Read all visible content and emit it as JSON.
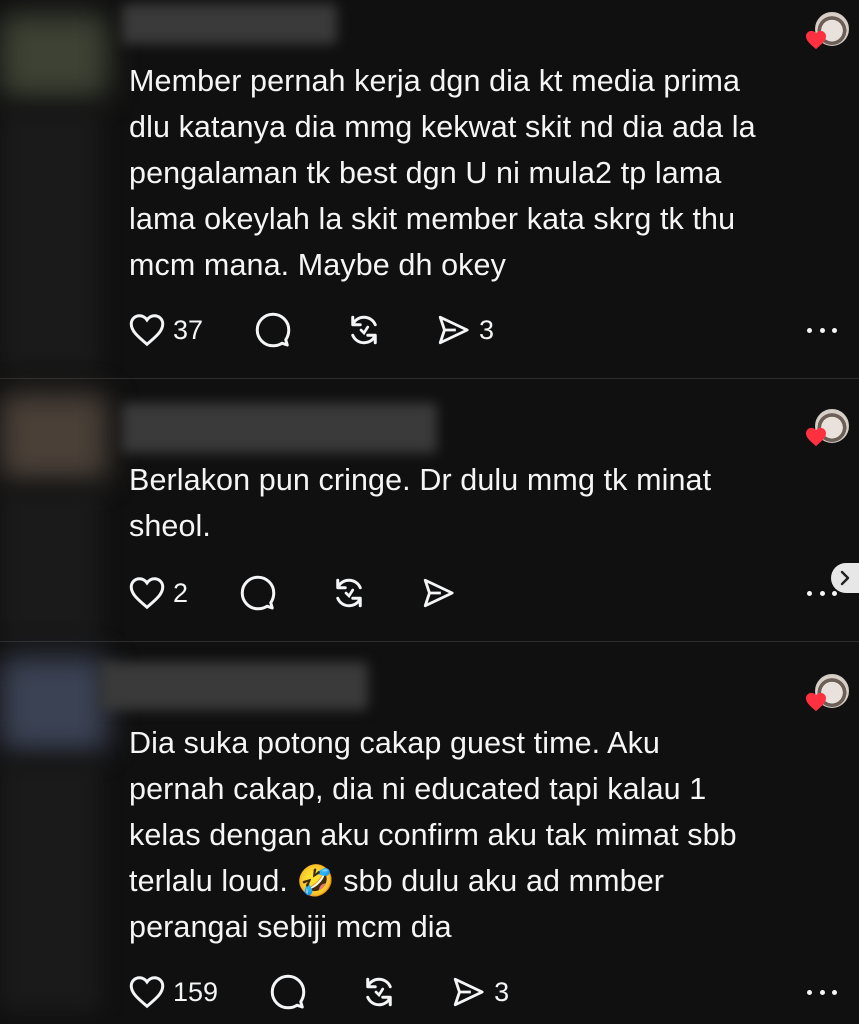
{
  "posts": [
    {
      "text": "Member pernah kerja dgn dia kt media prima\ndlu katanya dia mmg kekwat skit nd dia ada la\npengalaman tk best dgn U ni mula2 tp lama\nlama okeylah la skit member kata skrg tk thu\nmcm mana. Maybe dh okey",
      "likes": "37",
      "shares": "3"
    },
    {
      "text": "Berlakon pun cringe. Dr dulu mmg tk minat\nsheol.",
      "likes": "2",
      "shares": ""
    },
    {
      "text": "Dia suka potong cakap guest time. Aku\npernah cakap, dia ni educated tapi kalau 1\nkelas dengan aku confirm aku tak mimat sbb\nterlalu loud. 🤣 sbb dulu aku ad mmber\nperangai sebiji mcm dia",
      "likes": "159",
      "shares": "3"
    }
  ],
  "icons": {
    "like": "heart-outline-icon",
    "reply": "comment-bubble-icon",
    "repost": "repost-icon",
    "share": "send-icon",
    "more": "more-dots-icon",
    "liked_by_author": "heart-filled-icon"
  },
  "colors": {
    "background": "#101010",
    "text": "#f3f5f7",
    "heart": "#ff3040",
    "divider": "#2d2d2d"
  }
}
